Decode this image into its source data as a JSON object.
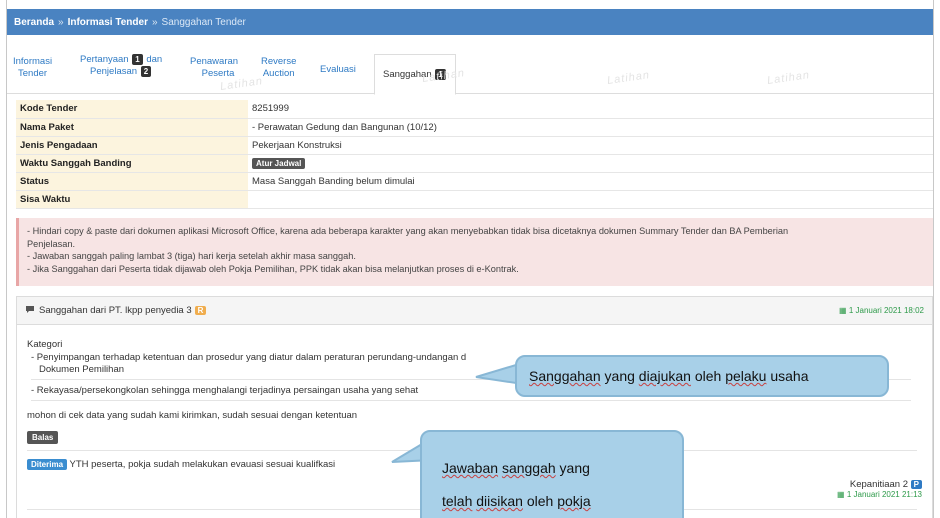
{
  "breadcrumb": {
    "home": "Beranda",
    "separator": "»",
    "info": "Informasi Tender",
    "current": "Sanggahan Tender"
  },
  "tabs": [
    {
      "line1": "Informasi",
      "line2": "Tender"
    },
    {
      "line1a": "Pertanyaan",
      "num1": "1",
      "line1b": "dan",
      "line2a": "Penjelasan",
      "num2": "2"
    },
    {
      "line1": "Penawaran",
      "line2": "Peserta"
    },
    {
      "line1": "Reverse",
      "line2": "Auction"
    },
    {
      "label": "Evaluasi"
    },
    {
      "label": "Sanggahan",
      "num": "1"
    }
  ],
  "watermark_text": "Latihan",
  "info": {
    "kode_label": "Kode Tender",
    "kode_value": "8251999",
    "paket_label": "Nama Paket",
    "paket_value": "- Perawatan Gedung dan Bangunan (10/12)",
    "jenis_label": "Jenis Pengadaan",
    "jenis_value": "Pekerjaan Konstruksi",
    "waktu_label": "Waktu Sanggah Banding",
    "waktu_button": "Atur Jadwal",
    "status_label": "Status",
    "status_value": "Masa Sanggah Banding belum dimulai",
    "sisa_label": "Sisa Waktu",
    "sisa_value": ""
  },
  "warning": {
    "line1": "- Hindari copy & paste dari dokumen aplikasi Microsoft Office, karena ada beberapa karakter yang akan menyebabkan tidak bisa dicetaknya dokumen Summary Tender dan BA Pemberian",
    "line1b": "Penjelasan.",
    "line2": "- Jawaban sanggah paling lambat 3 (tiga) hari kerja setelah akhir masa sanggah.",
    "line3": "- Jika Sanggahan dari Peserta tidak dijawab oleh Pokja Pemilihan, PPK tidak akan bisa melanjutkan proses di e-Kontrak."
  },
  "sanggahan": {
    "title": "Sanggahan dari PT. lkpp penyedia 3",
    "badge": "R",
    "date": "1 Januari 2021 18:02",
    "kategori_label": "Kategori",
    "kategori_1a": "- Penyimpangan terhadap ketentuan dan prosedur yang diatur dalam peraturan perundang-undangan d",
    "kategori_1b": "Dokumen Pemilihan",
    "kategori_2": "- Rekayasa/persekongkolan sehingga menghalangi terjadinya persaingan usaha yang sehat",
    "message": "mohon di cek data yang sudah kami kirimkan, sudah sesuai dengan ketentuan",
    "balas_button": "Balas",
    "reply_badge": "Diterima",
    "reply_text": "YTH  peserta, pokja sudah melakukan evauasi sesuai kualifkasi",
    "reply_author": "Kepanitiaan 2",
    "reply_author_badge": "P",
    "reply_date": "1 Januari 2021 21:13"
  },
  "callouts": {
    "one_parts": [
      "Sanggahan",
      " yang ",
      "diajukan",
      " oleh ",
      "pelaku",
      " usaha"
    ],
    "two_line1_parts": [
      "Jawaban",
      " ",
      "sanggah",
      " yang"
    ],
    "two_line2_parts": [
      "telah",
      " ",
      "diisikan",
      " oleh ",
      "pokja"
    ]
  },
  "colors": {
    "breadcrumb_bg": "#4a83c1",
    "callout_bg": "#a8d0e8"
  }
}
